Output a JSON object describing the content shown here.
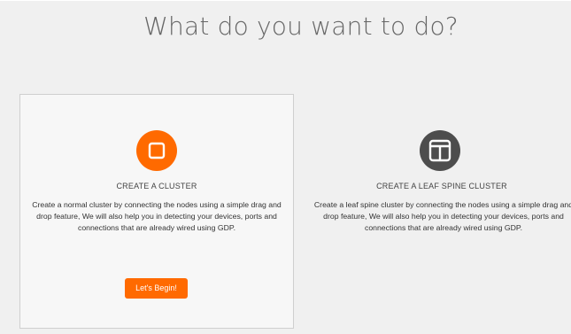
{
  "page": {
    "title": "What do you want to do?"
  },
  "options": [
    {
      "heading": "CREATE A CLUSTER",
      "description": "Create a normal cluster by connecting the nodes using a simple drag and drop feature, We will also help you in detecting your devices, ports and connections that are already wired using GDP.",
      "button_label": "Let's Begin!",
      "icon": "cluster-square-icon",
      "icon_color": "#ff6a00"
    },
    {
      "heading": "CREATE A LEAF SPINE CLUSTER",
      "description": "Create a leaf spine cluster by connecting the nodes using a simple drag and drop feature, We will also help you in detecting your devices, ports and connections that are already wired using GDP.",
      "icon": "leaf-spine-icon",
      "icon_color": "#4d4d4d"
    }
  ],
  "colors": {
    "accent": "#ff6a00",
    "background": "#f0f0f0",
    "selected_card": "#f7f7f7",
    "text": "#333333"
  }
}
